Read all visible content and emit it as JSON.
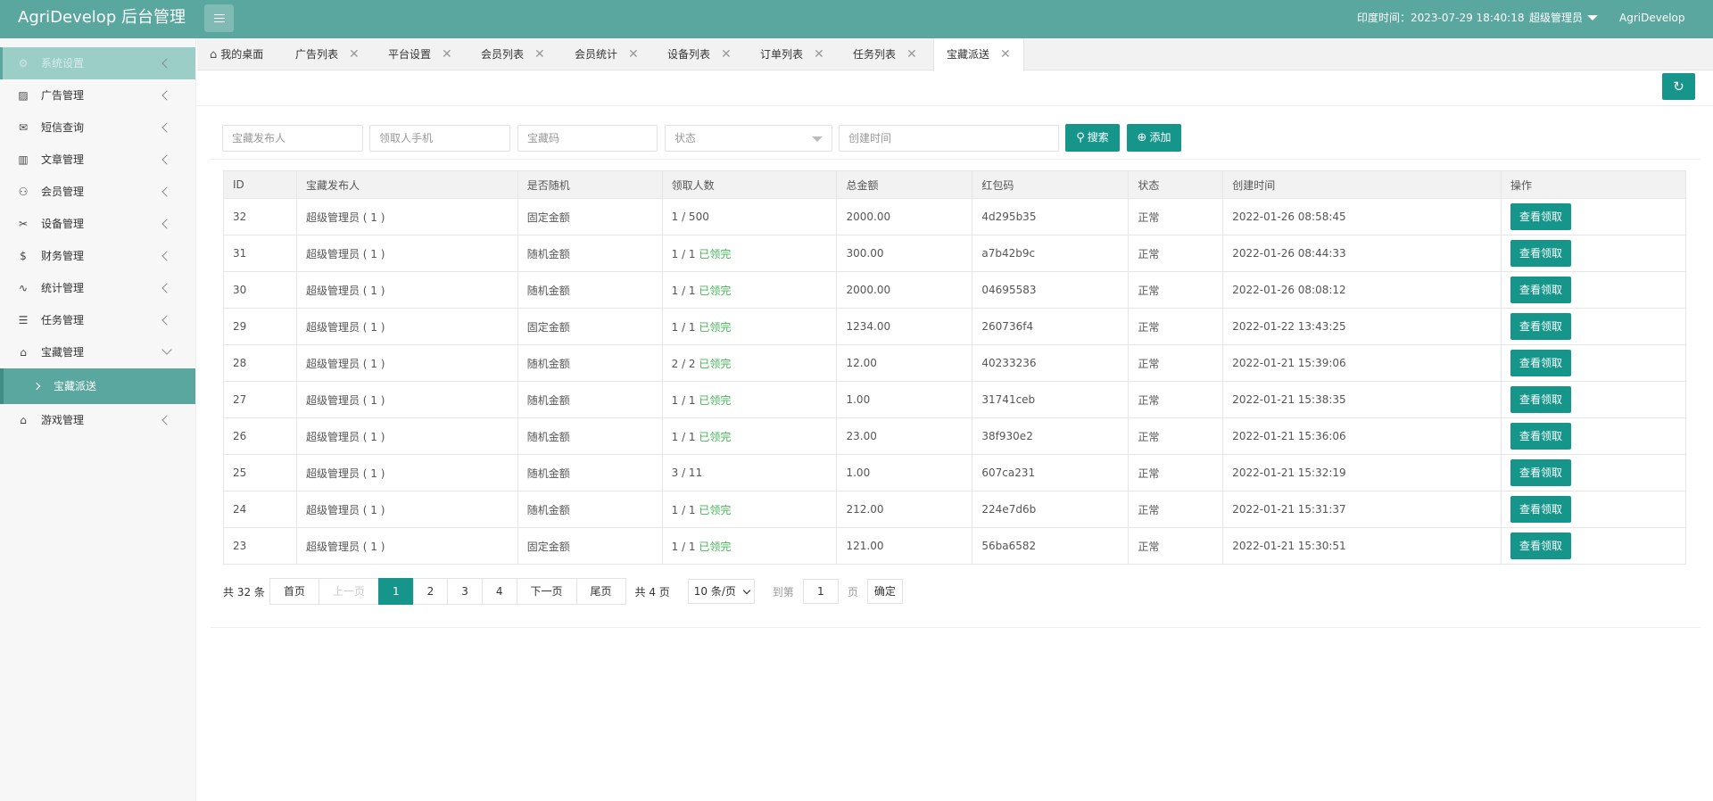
{
  "header": {
    "logo": "AgriDevelop 后台管理",
    "time_label": "印度时间：2023-07-29 18:40:18",
    "user": "超级管理员",
    "brand": "AgriDevelop"
  },
  "sidebar": {
    "items": [
      {
        "label": "系统设置",
        "icon": "⚙"
      },
      {
        "label": "广告管理",
        "icon": "▨"
      },
      {
        "label": "短信查询",
        "icon": "✉"
      },
      {
        "label": "文章管理",
        "icon": "▥"
      },
      {
        "label": "会员管理",
        "icon": "⚇"
      },
      {
        "label": "设备管理",
        "icon": "✂"
      },
      {
        "label": "财务管理",
        "icon": "$"
      },
      {
        "label": "统计管理",
        "icon": "∿"
      },
      {
        "label": "任务管理",
        "icon": "☰"
      },
      {
        "label": "宝藏管理",
        "icon": "⌂"
      }
    ],
    "sub_item": "宝藏派送",
    "last_item": {
      "label": "游戏管理",
      "icon": "⌂"
    }
  },
  "tabs": [
    {
      "label": "我的桌面"
    },
    {
      "label": "广告列表"
    },
    {
      "label": "平台设置"
    },
    {
      "label": "会员列表"
    },
    {
      "label": "会员统计"
    },
    {
      "label": "设备列表"
    },
    {
      "label": "订单列表"
    },
    {
      "label": "任务列表"
    },
    {
      "label": "宝藏派送"
    }
  ],
  "tab_close": "✕",
  "search": {
    "publisher_placeholder": "宝藏发布人",
    "phone_placeholder": "领取人手机",
    "code_placeholder": "宝藏码",
    "status_placeholder": "状态",
    "time_placeholder": "创建时间",
    "search_label": "搜索",
    "add_label": "添加"
  },
  "table": {
    "headers": [
      "ID",
      "宝藏发布人",
      "是否随机",
      "领取人数",
      "总金额",
      "红包码",
      "状态",
      "创建时间",
      "操作"
    ],
    "rows": [
      {
        "id": "32",
        "publisher": "超级管理员 ( 1 )",
        "random": "固定金额",
        "random_color": "green",
        "count": "1 / 500",
        "done": "",
        "amount": "2000.00",
        "code": "4d295b35",
        "status": "正常",
        "time": "2022-01-26 08:58:45",
        "action": "查看领取"
      },
      {
        "id": "31",
        "publisher": "超级管理员 ( 1 )",
        "random": "随机金额",
        "random_color": "red",
        "count": "1 / 1",
        "done": "已领完",
        "amount": "300.00",
        "code": "a7b42b9c",
        "status": "正常",
        "time": "2022-01-26 08:44:33",
        "action": "查看领取"
      },
      {
        "id": "30",
        "publisher": "超级管理员 ( 1 )",
        "random": "随机金额",
        "random_color": "red",
        "count": "1 / 1",
        "done": "已领完",
        "amount": "2000.00",
        "code": "04695583",
        "status": "正常",
        "time": "2022-01-26 08:08:12",
        "action": "查看领取"
      },
      {
        "id": "29",
        "publisher": "超级管理员 ( 1 )",
        "random": "固定金额",
        "random_color": "green",
        "count": "1 / 1",
        "done": "已领完",
        "amount": "1234.00",
        "code": "260736f4",
        "status": "正常",
        "time": "2022-01-22 13:43:25",
        "action": "查看领取"
      },
      {
        "id": "28",
        "publisher": "超级管理员 ( 1 )",
        "random": "随机金额",
        "random_color": "red",
        "count": "2 / 2",
        "done": "已领完",
        "amount": "12.00",
        "code": "40233236",
        "status": "正常",
        "time": "2022-01-21 15:39:06",
        "action": "查看领取"
      },
      {
        "id": "27",
        "publisher": "超级管理员 ( 1 )",
        "random": "随机金额",
        "random_color": "red",
        "count": "1 / 1",
        "done": "已领完",
        "amount": "1.00",
        "code": "31741ceb",
        "status": "正常",
        "time": "2022-01-21 15:38:35",
        "action": "查看领取"
      },
      {
        "id": "26",
        "publisher": "超级管理员 ( 1 )",
        "random": "随机金额",
        "random_color": "red",
        "count": "1 / 1",
        "done": "已领完",
        "amount": "23.00",
        "code": "38f930e2",
        "status": "正常",
        "time": "2022-01-21 15:36:06",
        "action": "查看领取"
      },
      {
        "id": "25",
        "publisher": "超级管理员 ( 1 )",
        "random": "随机金额",
        "random_color": "red",
        "count": "3 / 11",
        "done": "",
        "amount": "1.00",
        "code": "607ca231",
        "status": "正常",
        "time": "2022-01-21 15:32:19",
        "action": "查看领取"
      },
      {
        "id": "24",
        "publisher": "超级管理员 ( 1 )",
        "random": "随机金额",
        "random_color": "red",
        "count": "1 / 1",
        "done": "已领完",
        "amount": "212.00",
        "code": "224e7d6b",
        "status": "正常",
        "time": "2022-01-21 15:31:37",
        "action": "查看领取"
      },
      {
        "id": "23",
        "publisher": "超级管理员 ( 1 )",
        "random": "固定金额",
        "random_color": "green",
        "count": "1 / 1",
        "done": "已领完",
        "amount": "121.00",
        "code": "56ba6582",
        "status": "正常",
        "time": "2022-01-21 15:30:51",
        "action": "查看领取"
      }
    ]
  },
  "pager": {
    "total": "共 32 条",
    "first": "首页",
    "prev": "上一页",
    "pages": [
      "1",
      "2",
      "3",
      "4"
    ],
    "active_page": "1",
    "next": "下一页",
    "last": "尾页",
    "count": "共 4 页",
    "limit": "10 条/页",
    "goto": "到第",
    "goto_value": "1",
    "unit": "页",
    "ok": "确定"
  },
  "colors": {
    "accent": "#16968b",
    "header": "#5aa79f",
    "green": "#45b356",
    "red": "#ef5a3f"
  }
}
